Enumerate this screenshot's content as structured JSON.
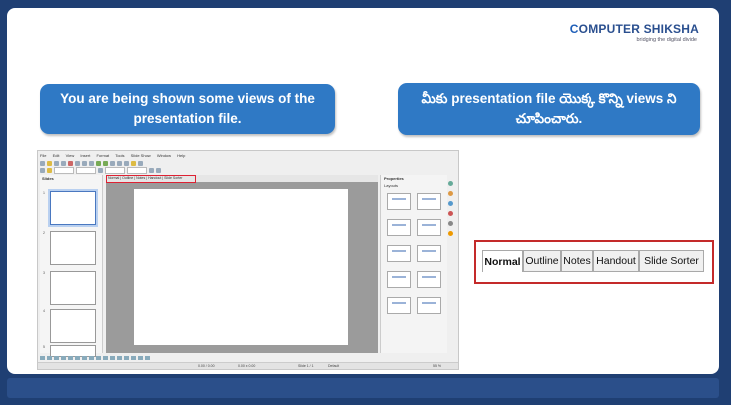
{
  "logo": {
    "brand_part1": "C",
    "brand_part2": "OMPUTER SHIKSHA",
    "tagline": "bridging the digital divide"
  },
  "callouts": {
    "english": "You are being shown some views of the presentation file.",
    "telugu": "మీకు presentation file యొక్క కొన్ని views ని చూపించారు."
  },
  "screenshot": {
    "menu": [
      "File",
      "Edit",
      "View",
      "Insert",
      "Format",
      "Tools",
      "Slide Show",
      "Window",
      "Help"
    ],
    "slides_pane_title": "Slides",
    "slide_numbers": [
      "1",
      "2",
      "3",
      "4",
      "5"
    ],
    "properties_title": "Properties",
    "layouts_title": "Layouts",
    "tabs_text": "Normal | Outline | Notes | Handout | Slide Sorter",
    "status": {
      "position": "0.00 / 0.00",
      "size": "0.00 x 0.00",
      "slide": "Slide 1 / 1",
      "layout": "Default",
      "zoom": "55 %"
    }
  },
  "view_tabs": [
    "Normal",
    "Outline",
    "Notes",
    "Handout",
    "Slide Sorter"
  ],
  "colors": {
    "callout_bg": "#2f79c5",
    "frame_bg": "#1f3f73",
    "highlight_border": "#c42a2a"
  }
}
